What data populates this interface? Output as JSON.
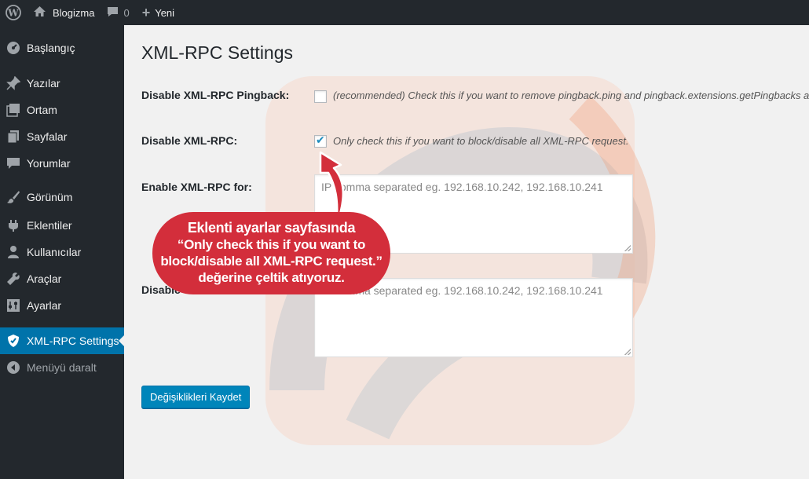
{
  "adminbar": {
    "site_name": "Blogizma",
    "comments_count": "0",
    "new_label": "Yeni"
  },
  "sidebar": {
    "items": [
      {
        "label": "Başlangıç",
        "icon": "dashboard-icon"
      },
      {
        "label": "Yazılar",
        "icon": "pin-icon"
      },
      {
        "label": "Ortam",
        "icon": "media-icon"
      },
      {
        "label": "Sayfalar",
        "icon": "pages-icon"
      },
      {
        "label": "Yorumlar",
        "icon": "comment-icon"
      },
      {
        "label": "Görünüm",
        "icon": "brush-icon"
      },
      {
        "label": "Eklentiler",
        "icon": "plugin-icon"
      },
      {
        "label": "Kullanıcılar",
        "icon": "user-icon"
      },
      {
        "label": "Araçlar",
        "icon": "wrench-icon"
      },
      {
        "label": "Ayarlar",
        "icon": "settings-icon"
      },
      {
        "label": "XML-RPC Settings",
        "icon": "shield-icon"
      }
    ],
    "collapse_label": "Menüyü daralt"
  },
  "main": {
    "title": "XML-RPC Settings",
    "rows": [
      {
        "label": "Disable XML-RPC Pingback:",
        "checked": false,
        "description": "(recommended) Check this if you want to remove pingback.ping and pingback.extensions.getPingbacks and X-"
      },
      {
        "label": "Disable XML-RPC:",
        "checked": true,
        "description": "Only check this if you want to block/disable all XML-RPC request."
      },
      {
        "label": "Enable XML-RPC for:",
        "placeholder": "IP comma separated eg. 192.168.10.242, 192.168.10.241"
      },
      {
        "label": "Disable",
        "placeholder": "IP comma separated eg. 192.168.10.242, 192.168.10.241"
      }
    ],
    "save_label": "Değişiklikleri Kaydet"
  },
  "callout": {
    "lines": [
      "Eklenti ayarlar sayfasında",
      "“Only check this if you want to",
      "block/disable all XML-RPC request.”",
      "değerine çeltik atıyoruz."
    ]
  },
  "colors": {
    "sidebar_bg": "#23282d",
    "active_menu": "#0073aa",
    "button": "#0085ba",
    "callout": "#d32e3b"
  }
}
